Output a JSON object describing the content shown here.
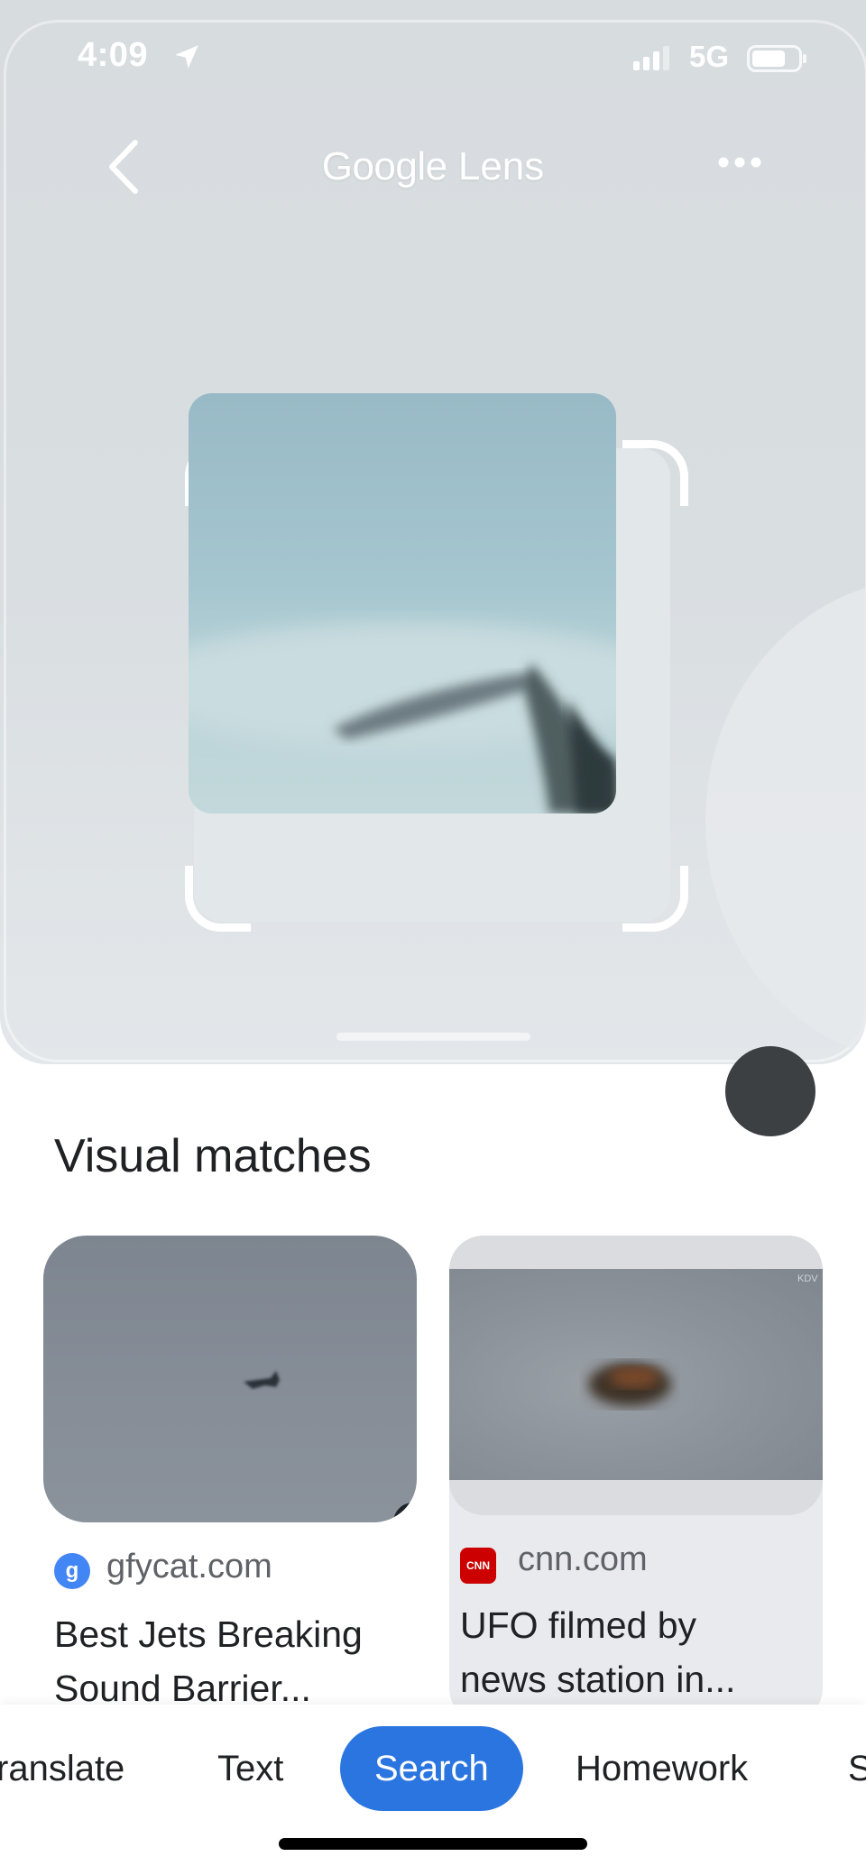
{
  "status_bar": {
    "time": "4:09",
    "network": "5G"
  },
  "header": {
    "title_google": "Google",
    "title_lens": "Lens"
  },
  "results": {
    "section_title": "Visual matches",
    "cards": [
      {
        "source": "gfycat.com",
        "favicon_letter": "g",
        "caption_line1": "Best Jets Breaking",
        "caption_line2": "Sound Barrier..."
      },
      {
        "source": "cnn.com",
        "favicon_letter": "CNN",
        "caption_line1": "UFO filmed by",
        "caption_line2": "news station in...",
        "watermark": "KDV"
      }
    ]
  },
  "tabs": {
    "items": [
      "ranslate",
      "Text",
      "Search",
      "Homework",
      "S"
    ],
    "selected": "Search"
  },
  "colors": {
    "accent": "#2b75e0",
    "panel": "#d8dde0"
  },
  "icons": [
    "location-arrow-icon",
    "signal-icon",
    "battery-icon",
    "back-chevron-icon",
    "more-horizontal-icon"
  ]
}
